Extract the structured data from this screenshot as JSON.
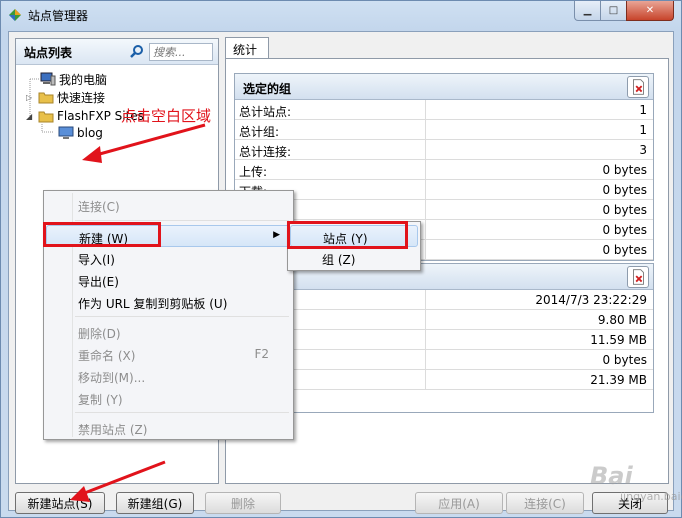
{
  "window": {
    "title": "站点管理器",
    "controls": {
      "minimize": "▁",
      "maximize": "□",
      "close": "✕"
    }
  },
  "sidebar": {
    "title": "站点列表",
    "search_placeholder": "搜索...",
    "tree": [
      {
        "label": "我的电脑",
        "icon": "computer-icon"
      },
      {
        "label": "快速连接",
        "icon": "folder-icon"
      },
      {
        "label": "FlashFXP Sites",
        "icon": "folder-icon"
      },
      {
        "label": "blog",
        "icon": "monitor-icon"
      }
    ]
  },
  "tabs": [
    {
      "label": "统计"
    }
  ],
  "selected_group": {
    "title": "选定的组",
    "rows": [
      {
        "key": "总计站点:",
        "value": "1"
      },
      {
        "key": "总计组:",
        "value": "1"
      },
      {
        "key": "总计连接:",
        "value": "3"
      },
      {
        "key": "上传:",
        "value": "0 bytes"
      },
      {
        "key": "下载:",
        "value": "0 bytes"
      },
      {
        "key": "",
        "value": "0 bytes"
      },
      {
        "key": "",
        "value": "0 bytes"
      },
      {
        "key": "",
        "value": "0 bytes"
      }
    ]
  },
  "second_group": {
    "title": "",
    "rows": [
      {
        "key": "",
        "value": "2014/7/3 23:22:29"
      },
      {
        "key": "",
        "value": "9.80 MB"
      },
      {
        "key": "",
        "value": "11.59 MB"
      },
      {
        "key": "",
        "value": "0 bytes"
      },
      {
        "key": "",
        "value": "21.39 MB"
      }
    ]
  },
  "context_menu": {
    "items": [
      {
        "label": "连接(C)",
        "shortcut": "",
        "disabled": true
      },
      {
        "label": "新建 (W)",
        "shortcut": "",
        "disabled": false,
        "submenu": true
      },
      {
        "label": "导入(I)",
        "shortcut": "",
        "disabled": false
      },
      {
        "label": "导出(E)",
        "shortcut": "",
        "disabled": false
      },
      {
        "label": "作为 URL 复制到剪贴板 (U)",
        "shortcut": "",
        "disabled": false
      },
      {
        "label": "删除(D)",
        "shortcut": "",
        "disabled": true
      },
      {
        "label": "重命名 (X)",
        "shortcut": "F2",
        "disabled": true
      },
      {
        "label": "移动到(M)...",
        "shortcut": "",
        "disabled": true
      },
      {
        "label": "复制 (Y)",
        "shortcut": "",
        "disabled": true
      },
      {
        "label": "禁用站点 (Z)",
        "shortcut": "",
        "disabled": true
      }
    ],
    "submenu_arrow": "▶"
  },
  "submenu": {
    "items": [
      {
        "label": "站点 (Y)"
      },
      {
        "label": "组 (Z)"
      }
    ]
  },
  "buttons": {
    "new_site": "新建站点(S)",
    "new_group": "新建组(G)",
    "delete": "删除",
    "apply": "应用(A)",
    "connect": "连接(C)",
    "close": "关闭"
  },
  "annotation": {
    "text": "点击空白区域",
    "color": "#e1131b"
  },
  "watermark": {
    "text": "Bai",
    "sub": "jingyan.baidu"
  },
  "colors": {
    "highlight_box": "#e1131b",
    "window_frame": "#c3d6ec"
  }
}
